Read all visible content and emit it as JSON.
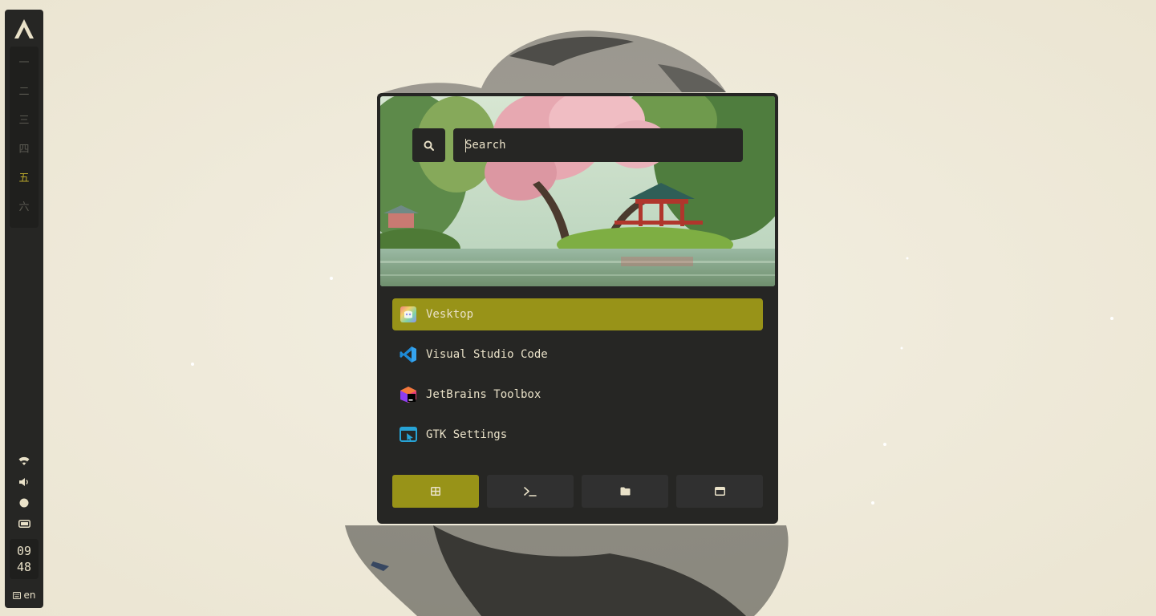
{
  "colors": {
    "accent": "#989318",
    "panel": "#262624",
    "text": "#e9e1c8",
    "workspace_active": "#b7a52c",
    "workspace_inactive": "#5b5a52"
  },
  "sidebar": {
    "logo_icon": "arch-logo-icon",
    "workspaces": [
      {
        "label": "一",
        "active": false
      },
      {
        "label": "二",
        "active": false
      },
      {
        "label": "三",
        "active": false
      },
      {
        "label": "四",
        "active": false
      },
      {
        "label": "五",
        "active": true
      },
      {
        "label": "六",
        "active": false
      }
    ],
    "tray_icons": [
      "wifi-icon",
      "volume-icon",
      "record-icon",
      "battery-icon"
    ],
    "clock": {
      "hour": "09",
      "minute": "48"
    },
    "keyboard": {
      "icon": "keyboard-icon",
      "layout": "en"
    }
  },
  "launcher": {
    "search": {
      "placeholder": "Search",
      "value": "",
      "icon": "search-icon"
    },
    "apps": [
      {
        "name": "Vesktop",
        "icon": "vesktop-icon",
        "selected": true
      },
      {
        "name": "Visual Studio Code",
        "icon": "vscode-icon",
        "selected": false
      },
      {
        "name": "JetBrains Toolbox",
        "icon": "jetbrains-toolbox-icon",
        "selected": false
      },
      {
        "name": "GTK Settings",
        "icon": "gtk-settings-icon",
        "selected": false
      }
    ],
    "modes": [
      {
        "icon": "apps-grid-icon",
        "active": true
      },
      {
        "icon": "terminal-icon",
        "active": false
      },
      {
        "icon": "folder-icon",
        "active": false
      },
      {
        "icon": "window-icon",
        "active": false
      }
    ]
  }
}
